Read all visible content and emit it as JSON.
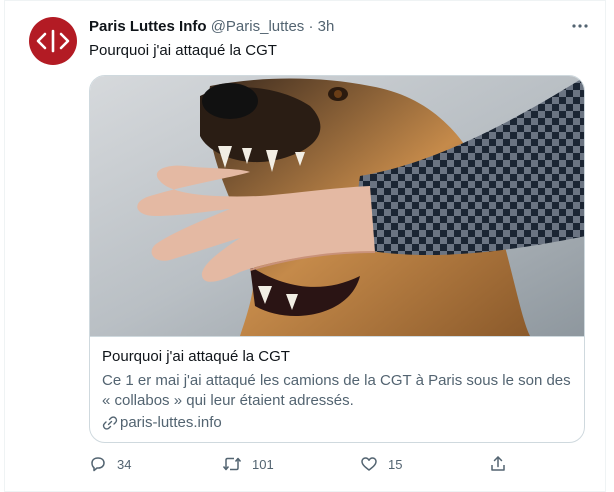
{
  "author": {
    "name": "Paris Luttes Info",
    "handle": "@Paris_luttes",
    "separator": "·",
    "time": "3h",
    "avatar_colors": {
      "bg": "#b31b24",
      "fg": "#ffffff"
    }
  },
  "tweet": {
    "text": "Pourquoi j'ai attaqué la CGT"
  },
  "card": {
    "title": "Pourquoi j'ai attaqué la CGT",
    "description": "Ce 1 er mai j'ai attaqué les camions de la CGT à Paris sous le son des « collabos » qui leur étaient adressés.",
    "domain": "paris-luttes.info",
    "image_alt": "dog biting a hand"
  },
  "actions": {
    "reply_count": "34",
    "retweet_count": "101",
    "like_count": "15"
  },
  "icons": {
    "more": "more-horizontal-icon",
    "link": "link-icon",
    "reply": "reply-icon",
    "retweet": "retweet-icon",
    "like": "heart-icon",
    "share": "share-icon"
  },
  "colors": {
    "text": "#0f1419",
    "secondary": "#536471",
    "border": "#cfd9de",
    "brand": "#b31b24"
  }
}
